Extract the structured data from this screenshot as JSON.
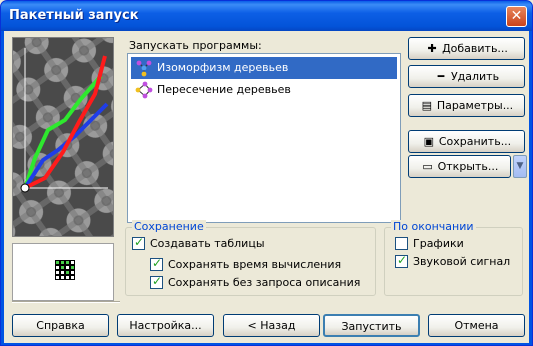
{
  "window": {
    "title": "Пакетный запуск"
  },
  "programs": {
    "label": "Запускать программы:",
    "items": [
      {
        "label": "Изоморфизм деревьев",
        "selected": true,
        "icon": "tree-icon"
      },
      {
        "label": "Пересечение деревьев",
        "selected": false,
        "icon": "tree-intersection-icon"
      }
    ]
  },
  "actions": {
    "add": "Добавить...",
    "remove": "Удалить",
    "params": "Параметры...",
    "save": "Сохранить...",
    "open": "Открыть..."
  },
  "saving": {
    "title": "Сохранение",
    "create_tables": "Создавать таблицы",
    "save_time": "Сохранять время вычисления",
    "save_no_prompt": "Сохранять без запроса описания"
  },
  "on_finish": {
    "title": "По окончании",
    "graphs": "Графики",
    "sound": "Звуковой сигнал"
  },
  "checks": {
    "create_tables": true,
    "save_time": true,
    "save_no_prompt": true,
    "graphs": false,
    "sound": true
  },
  "footer": {
    "help": "Справка",
    "settings": "Настройка...",
    "back": "< Назад",
    "run": "Запустить",
    "cancel": "Отмена"
  },
  "colors": {
    "selection": "#316ac5",
    "title_bar": "#0054e3",
    "legend": "#0046d5",
    "series": [
      "#ff1b1b",
      "#2ee92e",
      "#1f3de8"
    ]
  }
}
